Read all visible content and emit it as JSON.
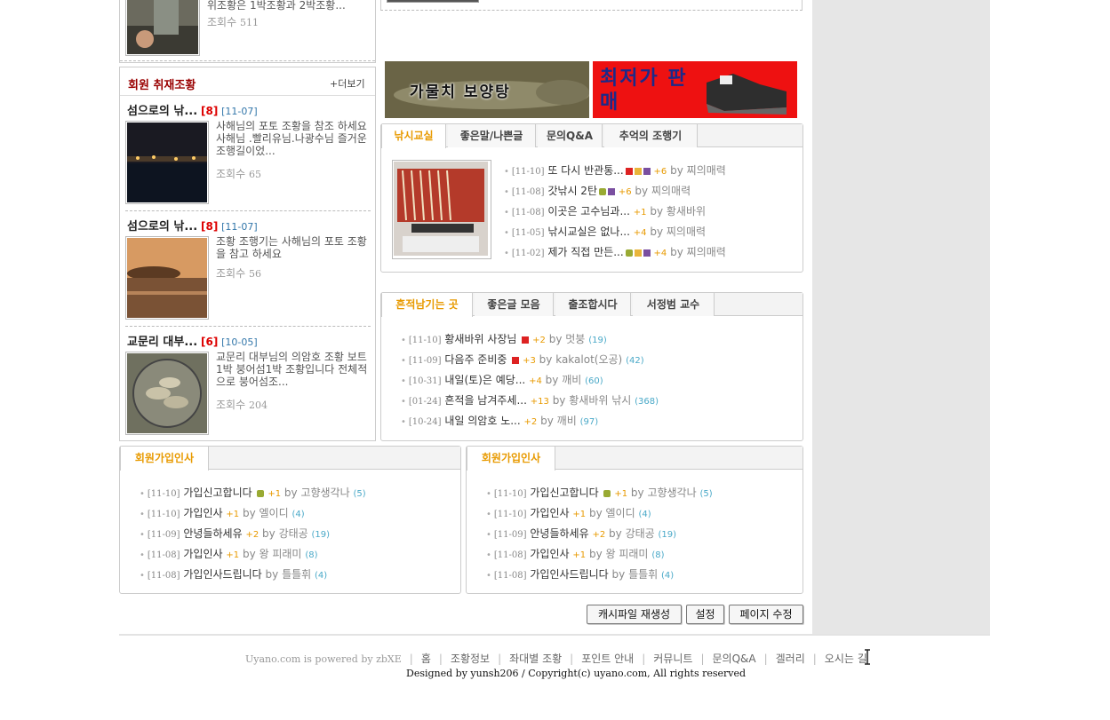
{
  "top_item": {
    "desc_tail": "위조황은 1박조황과 2박조황...",
    "views_label": "조회수",
    "views": "511"
  },
  "member_report": {
    "title": "회원 취재조황",
    "more": "+더보기",
    "items": [
      {
        "title": "섬으로의 낚...",
        "count": "[8]",
        "date": "[11-07]",
        "desc": "사해님의 포토 조황을 참조 하세요사해님 .빨리유님.나광수님 즐거운 조행길이었...",
        "views_label": "조회수",
        "views": "65"
      },
      {
        "title": "섬으로의 낚...",
        "count": "[8]",
        "date": "[11-07]",
        "desc": "조황 조행기는 사해님의 포토 조황을 참고 하세요",
        "views_label": "조회수",
        "views": "56"
      },
      {
        "title": "교문리 대부...",
        "count": "[6]",
        "date": "[10-05]",
        "desc": "교문리 대부님의 의암호 조황 보트1박 붕어섬1박 조황입니다 전체적으로 붕어섬조...",
        "views_label": "조회수",
        "views": "204"
      }
    ]
  },
  "banners": {
    "left_text": "가물치 보양탕",
    "right_text": "최저가 판매"
  },
  "lesson_box": {
    "tabs": [
      "낚시교실",
      "좋은말/나쁜글",
      "문의Q&A",
      "추억의 조행기"
    ],
    "rows": [
      {
        "date": "[11-10]",
        "title": "또 다시 반관통...",
        "pts": "+6",
        "by": "by",
        "author": "찌의매력"
      },
      {
        "date": "[11-08]",
        "title": "갓낚시 2탄",
        "pts": "+6",
        "by": "by",
        "author": "찌의매력"
      },
      {
        "date": "[11-08]",
        "title": "이곳은 고수님과...",
        "pts": "+1",
        "by": "by",
        "author": "황새바위"
      },
      {
        "date": "[11-05]",
        "title": "낚시교실은 없나...",
        "pts": "+4",
        "by": "by",
        "author": "찌의매력"
      },
      {
        "date": "[11-02]",
        "title": "제가 직접 만든...",
        "pts": "+4",
        "by": "by",
        "author": "찌의매력"
      }
    ]
  },
  "trace_box": {
    "tabs": [
      "흔적남기는 곳",
      "좋은글 모음",
      "출조합시다",
      "서정범 교수"
    ],
    "rows": [
      {
        "date": "[11-10]",
        "title": "황새바위 사장님",
        "pts": "+2",
        "by": "by",
        "author": "멋붕",
        "comments": "(19)"
      },
      {
        "date": "[11-09]",
        "title": "다음주 준비중",
        "pts": "+3",
        "by": "by",
        "author": "kakalot(오공)",
        "comments": "(42)"
      },
      {
        "date": "[10-31]",
        "title": "내일(토)은 예당...",
        "pts": "+4",
        "by": "by",
        "author": "깨비",
        "comments": "(60)"
      },
      {
        "date": "[01-24]",
        "title": "흔적을 남겨주세...",
        "pts": "+13",
        "by": "by",
        "author": "황새바위 낚시",
        "comments": "(368)"
      },
      {
        "date": "[10-24]",
        "title": "내일 의암호 노...",
        "pts": "+2",
        "by": "by",
        "author": "깨비",
        "comments": "(97)"
      }
    ]
  },
  "greet_box": {
    "tab": "회원가입인사",
    "rows": [
      {
        "date": "[11-10]",
        "title": "가입신고합니다",
        "pts": "+1",
        "by": "by",
        "author": "고향생각나",
        "comments": "(5)"
      },
      {
        "date": "[11-10]",
        "title": "가입인사",
        "pts": "+1",
        "by": "by",
        "author": "엘이디",
        "comments": "(4)"
      },
      {
        "date": "[11-09]",
        "title": "안녕들하세유",
        "pts": "+2",
        "by": "by",
        "author": "강태공",
        "comments": "(19)"
      },
      {
        "date": "[11-08]",
        "title": "가입인사",
        "pts": "+1",
        "by": "by",
        "author": "왕 피래미",
        "comments": "(8)"
      },
      {
        "date": "[11-08]",
        "title": "가입인사드립니다",
        "pts": "",
        "by": "by",
        "author": "틀틀휘",
        "comments": "(4)"
      }
    ]
  },
  "buttons": {
    "cache": "캐시파일 재생성",
    "settings": "설정",
    "edit": "페이지 수정"
  },
  "footer": {
    "powered": "Uyano.com is powered by zbXE",
    "links": [
      "홈",
      "조황정보",
      "좌대별 조황",
      "포인트 안내",
      "커뮤니트",
      "문의Q&A",
      "겔러리",
      "오시는 길"
    ],
    "copyright": "Designed by yunsh206 / Copyright(c) uyano.com, All rights reserved"
  },
  "colors": {
    "accent": "#e89a00",
    "title_red": "#990000",
    "count_red": "#dd0000"
  }
}
